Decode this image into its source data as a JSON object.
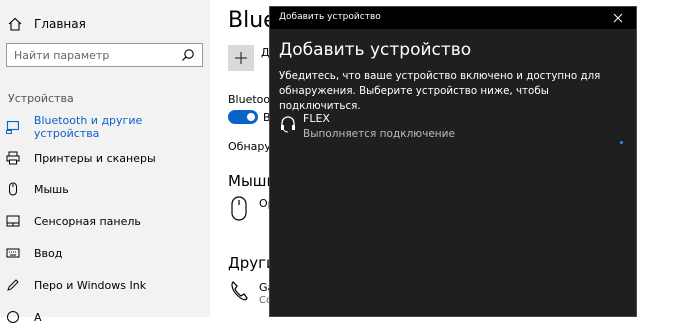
{
  "nav": {
    "home_label": "Главная",
    "search_placeholder": "Найти параметр",
    "section_label": "Устройства",
    "items": [
      {
        "label": "Bluetooth и другие устройства",
        "icon": "bluetooth-icon",
        "active": true
      },
      {
        "label": "Принтеры и сканеры",
        "icon": "printer-icon"
      },
      {
        "label": "Мышь",
        "icon": "mouse-icon"
      },
      {
        "label": "Сенсорная панель",
        "icon": "touchpad-icon"
      },
      {
        "label": "Ввод",
        "icon": "keyboard-icon"
      },
      {
        "label": "Перо и Windows Ink",
        "icon": "pen-icon"
      },
      {
        "label": "А",
        "icon": "autoplay-icon"
      }
    ]
  },
  "content": {
    "title": "Bluetoo",
    "add_device_label": "До",
    "bluetooth_label": "Bluetooth",
    "toggle_state": "В",
    "discover_text": "Обнаруж",
    "mouse_section_title": "Мышь, к",
    "mouse_device_text": "Ор",
    "other_section_title": "Другие",
    "other_device_text": "Ga",
    "other_device_sub": "Co"
  },
  "dialog": {
    "window_title": "Добавить устройство",
    "heading": "Добавить устройство",
    "description": "Убедитесь, что ваше устройство включено и доступно для обнаружения. Выберите устройство ниже, чтобы подключиться.",
    "device": {
      "name": "FLEX",
      "status": "Выполняется подключение",
      "icon": "headset-icon"
    }
  },
  "colors": {
    "accent": "#0a63c9",
    "dialog_bg": "#1f1f1f",
    "nav_bg": "#f2f2f2"
  }
}
